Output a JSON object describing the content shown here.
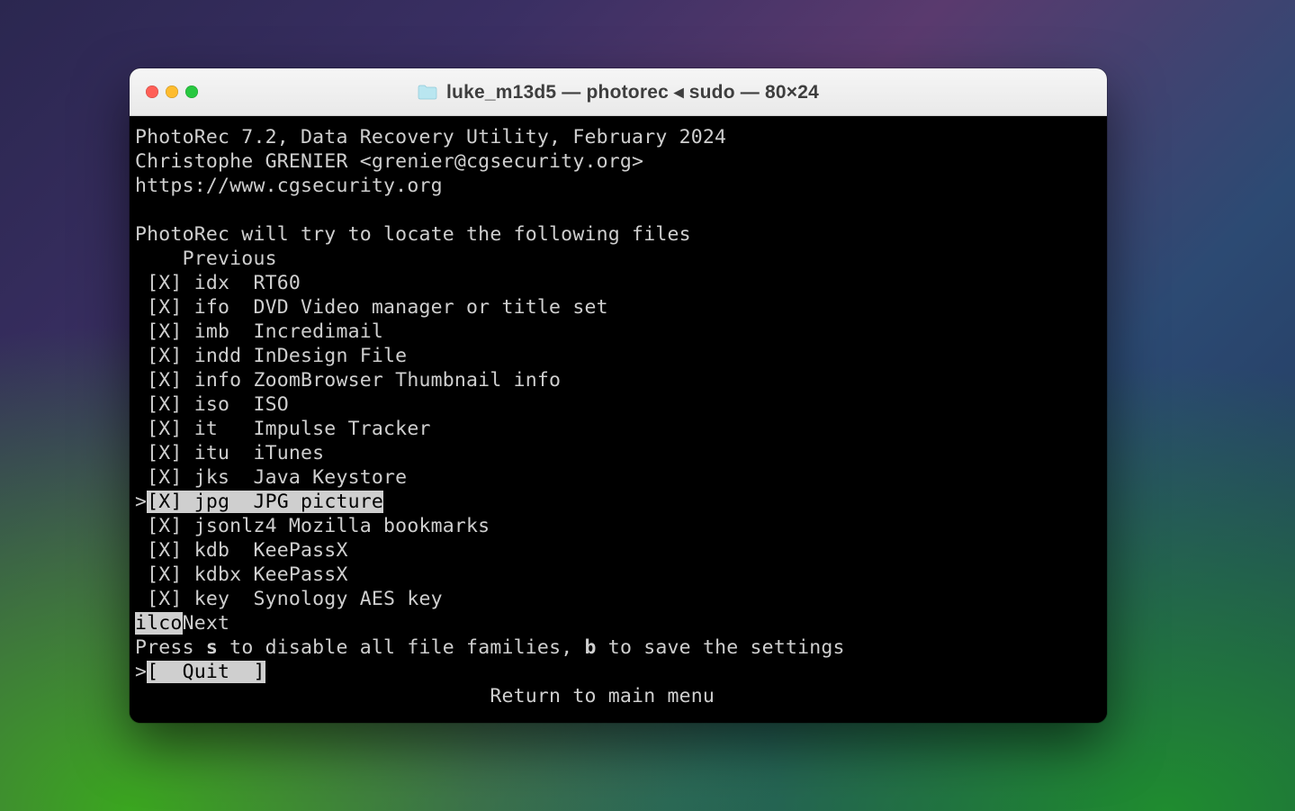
{
  "window": {
    "title": "luke_m13d5 — photorec ◂ sudo — 80×24"
  },
  "header": {
    "line1": "PhotoRec 7.2, Data Recovery Utility, February 2024",
    "line2": "Christophe GRENIER <grenier@cgsecurity.org>",
    "line3": "https://www.cgsecurity.org"
  },
  "intro": "PhotoRec will try to locate the following files",
  "previous_label": "    Previous",
  "items": [
    {
      "mark": "X",
      "ext": "idx",
      "desc": "RT60",
      "selected": false
    },
    {
      "mark": "X",
      "ext": "ifo",
      "desc": "DVD Video manager or title set",
      "selected": false
    },
    {
      "mark": "X",
      "ext": "imb",
      "desc": "Incredimail",
      "selected": false
    },
    {
      "mark": "X",
      "ext": "indd",
      "desc": "InDesign File",
      "selected": false
    },
    {
      "mark": "X",
      "ext": "info",
      "desc": "ZoomBrowser Thumbnail info",
      "selected": false
    },
    {
      "mark": "X",
      "ext": "iso",
      "desc": "ISO",
      "selected": false
    },
    {
      "mark": "X",
      "ext": "it",
      "desc": "Impulse Tracker",
      "selected": false
    },
    {
      "mark": "X",
      "ext": "itu",
      "desc": "iTunes",
      "selected": false
    },
    {
      "mark": "X",
      "ext": "jks",
      "desc": "Java Keystore",
      "selected": false
    },
    {
      "mark": "X",
      "ext": "jpg",
      "desc": "JPG picture",
      "selected": true
    },
    {
      "mark": "X",
      "ext": "jsonlz4",
      "desc": "Mozilla bookmarks",
      "selected": false,
      "nopad": true
    },
    {
      "mark": "X",
      "ext": "kdb",
      "desc": "KeePassX",
      "selected": false
    },
    {
      "mark": "X",
      "ext": "kdbx",
      "desc": "KeePassX",
      "selected": false
    },
    {
      "mark": "X",
      "ext": "key",
      "desc": "Synology AES key",
      "selected": false
    }
  ],
  "next": {
    "prefix": "ilco",
    "label": "Next"
  },
  "hint": {
    "pre": "Press ",
    "s": "s",
    "mid": " to disable all file families, ",
    "b": "b",
    "post": " to save the settings"
  },
  "quit": {
    "prefix": ">",
    "label": "[  Quit  ]"
  },
  "return": "                              Return to main menu"
}
